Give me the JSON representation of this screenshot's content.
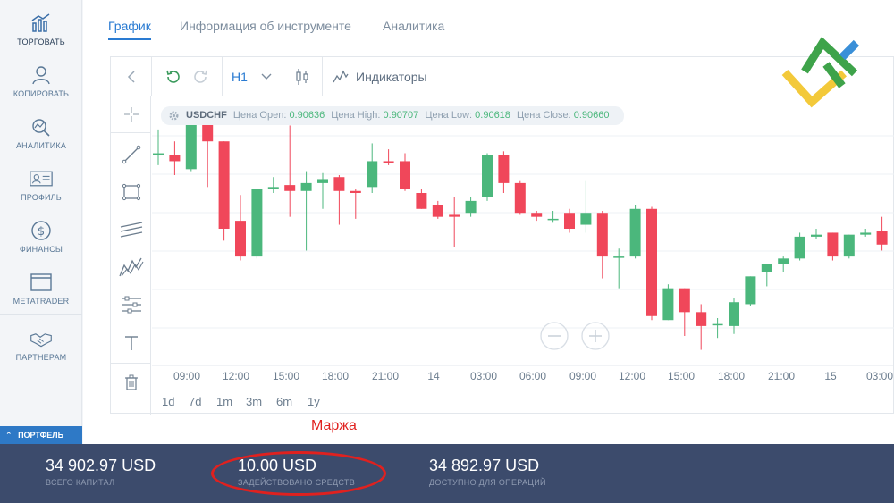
{
  "sidebar": {
    "items": [
      {
        "label": "ТОРГОВАТЬ",
        "icon": "chart-trade-icon"
      },
      {
        "label": "КОПИРОВАТЬ",
        "icon": "copy-trader-icon"
      },
      {
        "label": "АНАЛИТИКА",
        "icon": "analytics-icon"
      },
      {
        "label": "ПРОФИЛЬ",
        "icon": "profile-card-icon"
      },
      {
        "label": "ФИНАНСЫ",
        "icon": "dollar-coin-icon"
      },
      {
        "label": "METATRADER",
        "icon": "window-icon"
      },
      {
        "label": "ПАРТНЕРАМ",
        "icon": "handshake-icon"
      }
    ],
    "portfolio_label": "ПОРТФЕЛЬ"
  },
  "tabs": [
    {
      "label": "График"
    },
    {
      "label": "Информация об инструменте"
    },
    {
      "label": "Аналитика"
    }
  ],
  "toolbar": {
    "timeframe": "H1",
    "indicators_label": "Индикаторы"
  },
  "info_bar": {
    "symbol": "USDCHF",
    "open_label": "Цена Open:",
    "open": "0.90636",
    "high_label": "Цена High:",
    "high": "0.90707",
    "low_label": "Цена Low:",
    "low": "0.90618",
    "close_label": "Цена Close:",
    "close": "0.90660"
  },
  "time_labels": [
    "09:00",
    "12:00",
    "15:00",
    "18:00",
    "21:00",
    "14",
    "03:00",
    "06:00",
    "09:00",
    "12:00",
    "15:00",
    "18:00",
    "21:00",
    "15",
    "03:00"
  ],
  "range_buttons": [
    "1d",
    "7d",
    "1m",
    "3m",
    "6m",
    "1y"
  ],
  "annotation": "Маржа",
  "footer": {
    "total_value": "34 902.97 USD",
    "total_label": "ВСЕГО КАПИТАЛ",
    "used_value": "10.00 USD",
    "used_label": "ЗАДЕЙСТВОВАНО СРЕДСТВ",
    "available_value": "34 892.97 USD",
    "available_label": "ДОСТУПНО ДЛЯ ОПЕРАЦИЙ"
  },
  "colors": {
    "up": "#4bb77c",
    "down": "#f0475a",
    "accent": "#2a7bd2",
    "footer_bg": "#3c4b6c",
    "annotation": "#e0211f"
  },
  "chart_data": {
    "type": "candlestick",
    "symbol": "USDCHF",
    "interval": "H1",
    "candles": [
      {
        "o": 0.9079,
        "h": 0.9085,
        "l": 0.9076,
        "c": 0.9079
      },
      {
        "o": 0.90785,
        "h": 0.9082,
        "l": 0.90735,
        "c": 0.9077
      },
      {
        "o": 0.9075,
        "h": 0.909,
        "l": 0.90745,
        "c": 0.90875
      },
      {
        "o": 0.9088,
        "h": 0.9089,
        "l": 0.90705,
        "c": 0.9082
      },
      {
        "o": 0.9082,
        "h": 0.9082,
        "l": 0.9057,
        "c": 0.906
      },
      {
        "o": 0.9062,
        "h": 0.90685,
        "l": 0.9052,
        "c": 0.9053
      },
      {
        "o": 0.9053,
        "h": 0.907,
        "l": 0.90525,
        "c": 0.907
      },
      {
        "o": 0.907,
        "h": 0.9073,
        "l": 0.9069,
        "c": 0.90705
      },
      {
        "o": 0.9071,
        "h": 0.9086,
        "l": 0.9063,
        "c": 0.90695
      },
      {
        "o": 0.90695,
        "h": 0.90745,
        "l": 0.90545,
        "c": 0.90715
      },
      {
        "o": 0.90715,
        "h": 0.9074,
        "l": 0.9065,
        "c": 0.90725
      },
      {
        "o": 0.9073,
        "h": 0.90735,
        "l": 0.9061,
        "c": 0.90695
      },
      {
        "o": 0.90695,
        "h": 0.907,
        "l": 0.90625,
        "c": 0.9069
      },
      {
        "o": 0.90705,
        "h": 0.90815,
        "l": 0.9069,
        "c": 0.9077
      },
      {
        "o": 0.9077,
        "h": 0.908,
        "l": 0.9076,
        "c": 0.90765
      },
      {
        "o": 0.9077,
        "h": 0.9079,
        "l": 0.90695,
        "c": 0.907
      },
      {
        "o": 0.9069,
        "h": 0.907,
        "l": 0.9065,
        "c": 0.9065
      },
      {
        "o": 0.9066,
        "h": 0.9067,
        "l": 0.90625,
        "c": 0.9063
      },
      {
        "o": 0.90635,
        "h": 0.9068,
        "l": 0.90555,
        "c": 0.9063
      },
      {
        "o": 0.9064,
        "h": 0.9068,
        "l": 0.9063,
        "c": 0.9067
      },
      {
        "o": 0.9068,
        "h": 0.9079,
        "l": 0.9067,
        "c": 0.90785
      },
      {
        "o": 0.90785,
        "h": 0.90795,
        "l": 0.9069,
        "c": 0.90715
      },
      {
        "o": 0.90715,
        "h": 0.9072,
        "l": 0.90635,
        "c": 0.9064
      },
      {
        "o": 0.9064,
        "h": 0.90645,
        "l": 0.9062,
        "c": 0.9063
      },
      {
        "o": 0.90625,
        "h": 0.90645,
        "l": 0.90615,
        "c": 0.90625
      },
      {
        "o": 0.9064,
        "h": 0.9065,
        "l": 0.9059,
        "c": 0.906
      },
      {
        "o": 0.9061,
        "h": 0.9072,
        "l": 0.9059,
        "c": 0.9064
      },
      {
        "o": 0.9064,
        "h": 0.90645,
        "l": 0.90475,
        "c": 0.9053
      },
      {
        "o": 0.9053,
        "h": 0.9055,
        "l": 0.9045,
        "c": 0.9053
      },
      {
        "o": 0.9053,
        "h": 0.9066,
        "l": 0.90525,
        "c": 0.9065
      },
      {
        "o": 0.9065,
        "h": 0.90655,
        "l": 0.9037,
        "c": 0.9038
      },
      {
        "o": 0.9037,
        "h": 0.9046,
        "l": 0.9037,
        "c": 0.9045
      },
      {
        "o": 0.9045,
        "h": 0.9045,
        "l": 0.9033,
        "c": 0.9039
      },
      {
        "o": 0.9039,
        "h": 0.9041,
        "l": 0.90295,
        "c": 0.90355
      },
      {
        "o": 0.9036,
        "h": 0.90375,
        "l": 0.90325,
        "c": 0.9036
      },
      {
        "o": 0.90355,
        "h": 0.90425,
        "l": 0.90335,
        "c": 0.90415
      },
      {
        "o": 0.9041,
        "h": 0.9048,
        "l": 0.90405,
        "c": 0.9048
      },
      {
        "o": 0.9049,
        "h": 0.9051,
        "l": 0.90455,
        "c": 0.9051
      },
      {
        "o": 0.9051,
        "h": 0.9053,
        "l": 0.9049,
        "c": 0.90525
      },
      {
        "o": 0.90525,
        "h": 0.9059,
        "l": 0.9052,
        "c": 0.9058
      },
      {
        "o": 0.9058,
        "h": 0.906,
        "l": 0.90575,
        "c": 0.90585
      },
      {
        "o": 0.9059,
        "h": 0.9059,
        "l": 0.9052,
        "c": 0.9053
      },
      {
        "o": 0.9053,
        "h": 0.90585,
        "l": 0.90525,
        "c": 0.90585
      },
      {
        "o": 0.90585,
        "h": 0.906,
        "l": 0.9058,
        "c": 0.9059
      },
      {
        "o": 0.90595,
        "h": 0.9063,
        "l": 0.90545,
        "c": 0.9056
      }
    ]
  }
}
